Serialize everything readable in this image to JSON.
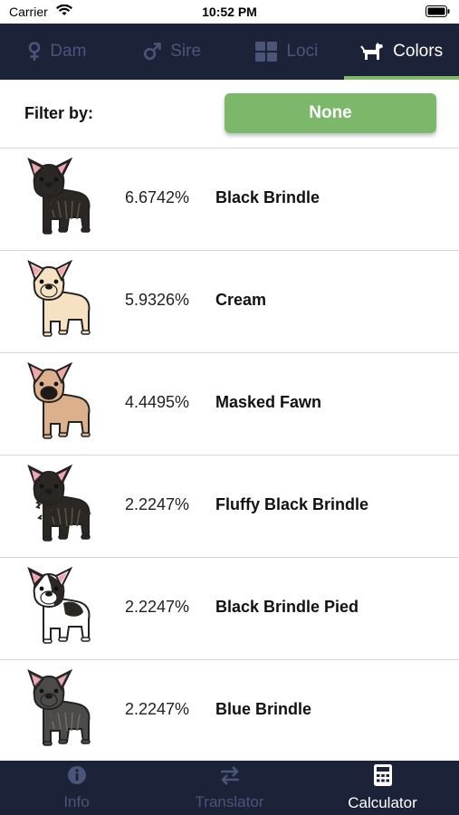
{
  "status": {
    "carrier": "Carrier",
    "time": "10:52 PM"
  },
  "top_tabs": [
    {
      "label": "Dam",
      "icon": "female-icon",
      "active": false
    },
    {
      "label": "Sire",
      "icon": "male-icon",
      "active": false
    },
    {
      "label": "Loci",
      "icon": "grid-icon",
      "active": false
    },
    {
      "label": "Colors",
      "icon": "dog-icon",
      "active": true
    }
  ],
  "filter": {
    "label": "Filter by:",
    "value": "None"
  },
  "results": [
    {
      "percent": "6.6742%",
      "name": "Black Brindle",
      "coat": "#2b2723",
      "stripe": "#5a5148",
      "muzzle": "#2b2723",
      "chest": "#2b2723"
    },
    {
      "percent": "5.9326%",
      "name": "Cream",
      "coat": "#f6e2c2",
      "stripe": "#f6e2c2",
      "muzzle": "#f6e2c2",
      "chest": "#f6e2c2"
    },
    {
      "percent": "4.4495%",
      "name": "Masked Fawn",
      "coat": "#dcb08b",
      "stripe": "#dcb08b",
      "muzzle": "#1e1b19",
      "chest": "#dcb08b"
    },
    {
      "percent": "2.2247%",
      "name": "Fluffy Black Brindle",
      "coat": "#2b2723",
      "stripe": "#5a5148",
      "muzzle": "#2b2723",
      "chest": "#2b2723"
    },
    {
      "percent": "2.2247%",
      "name": "Black Brindle Pied",
      "coat": "#ffffff",
      "stripe": "#2b2723",
      "muzzle": "#ffffff",
      "chest": "#ffffff"
    },
    {
      "percent": "2.2247%",
      "name": "Blue Brindle",
      "coat": "#4d4b4a",
      "stripe": "#6d6a67",
      "muzzle": "#4d4b4a",
      "chest": "#4d4b4a"
    }
  ],
  "bottom_tabs": [
    {
      "label": "Info",
      "icon": "info-icon",
      "active": false
    },
    {
      "label": "Translator",
      "icon": "swap-icon",
      "active": false
    },
    {
      "label": "Calculator",
      "icon": "calculator-icon",
      "active": true
    }
  ],
  "colors": {
    "nav_bg": "#1c2238",
    "accent_green": "#7bb86a",
    "inactive": "#4b5577"
  }
}
